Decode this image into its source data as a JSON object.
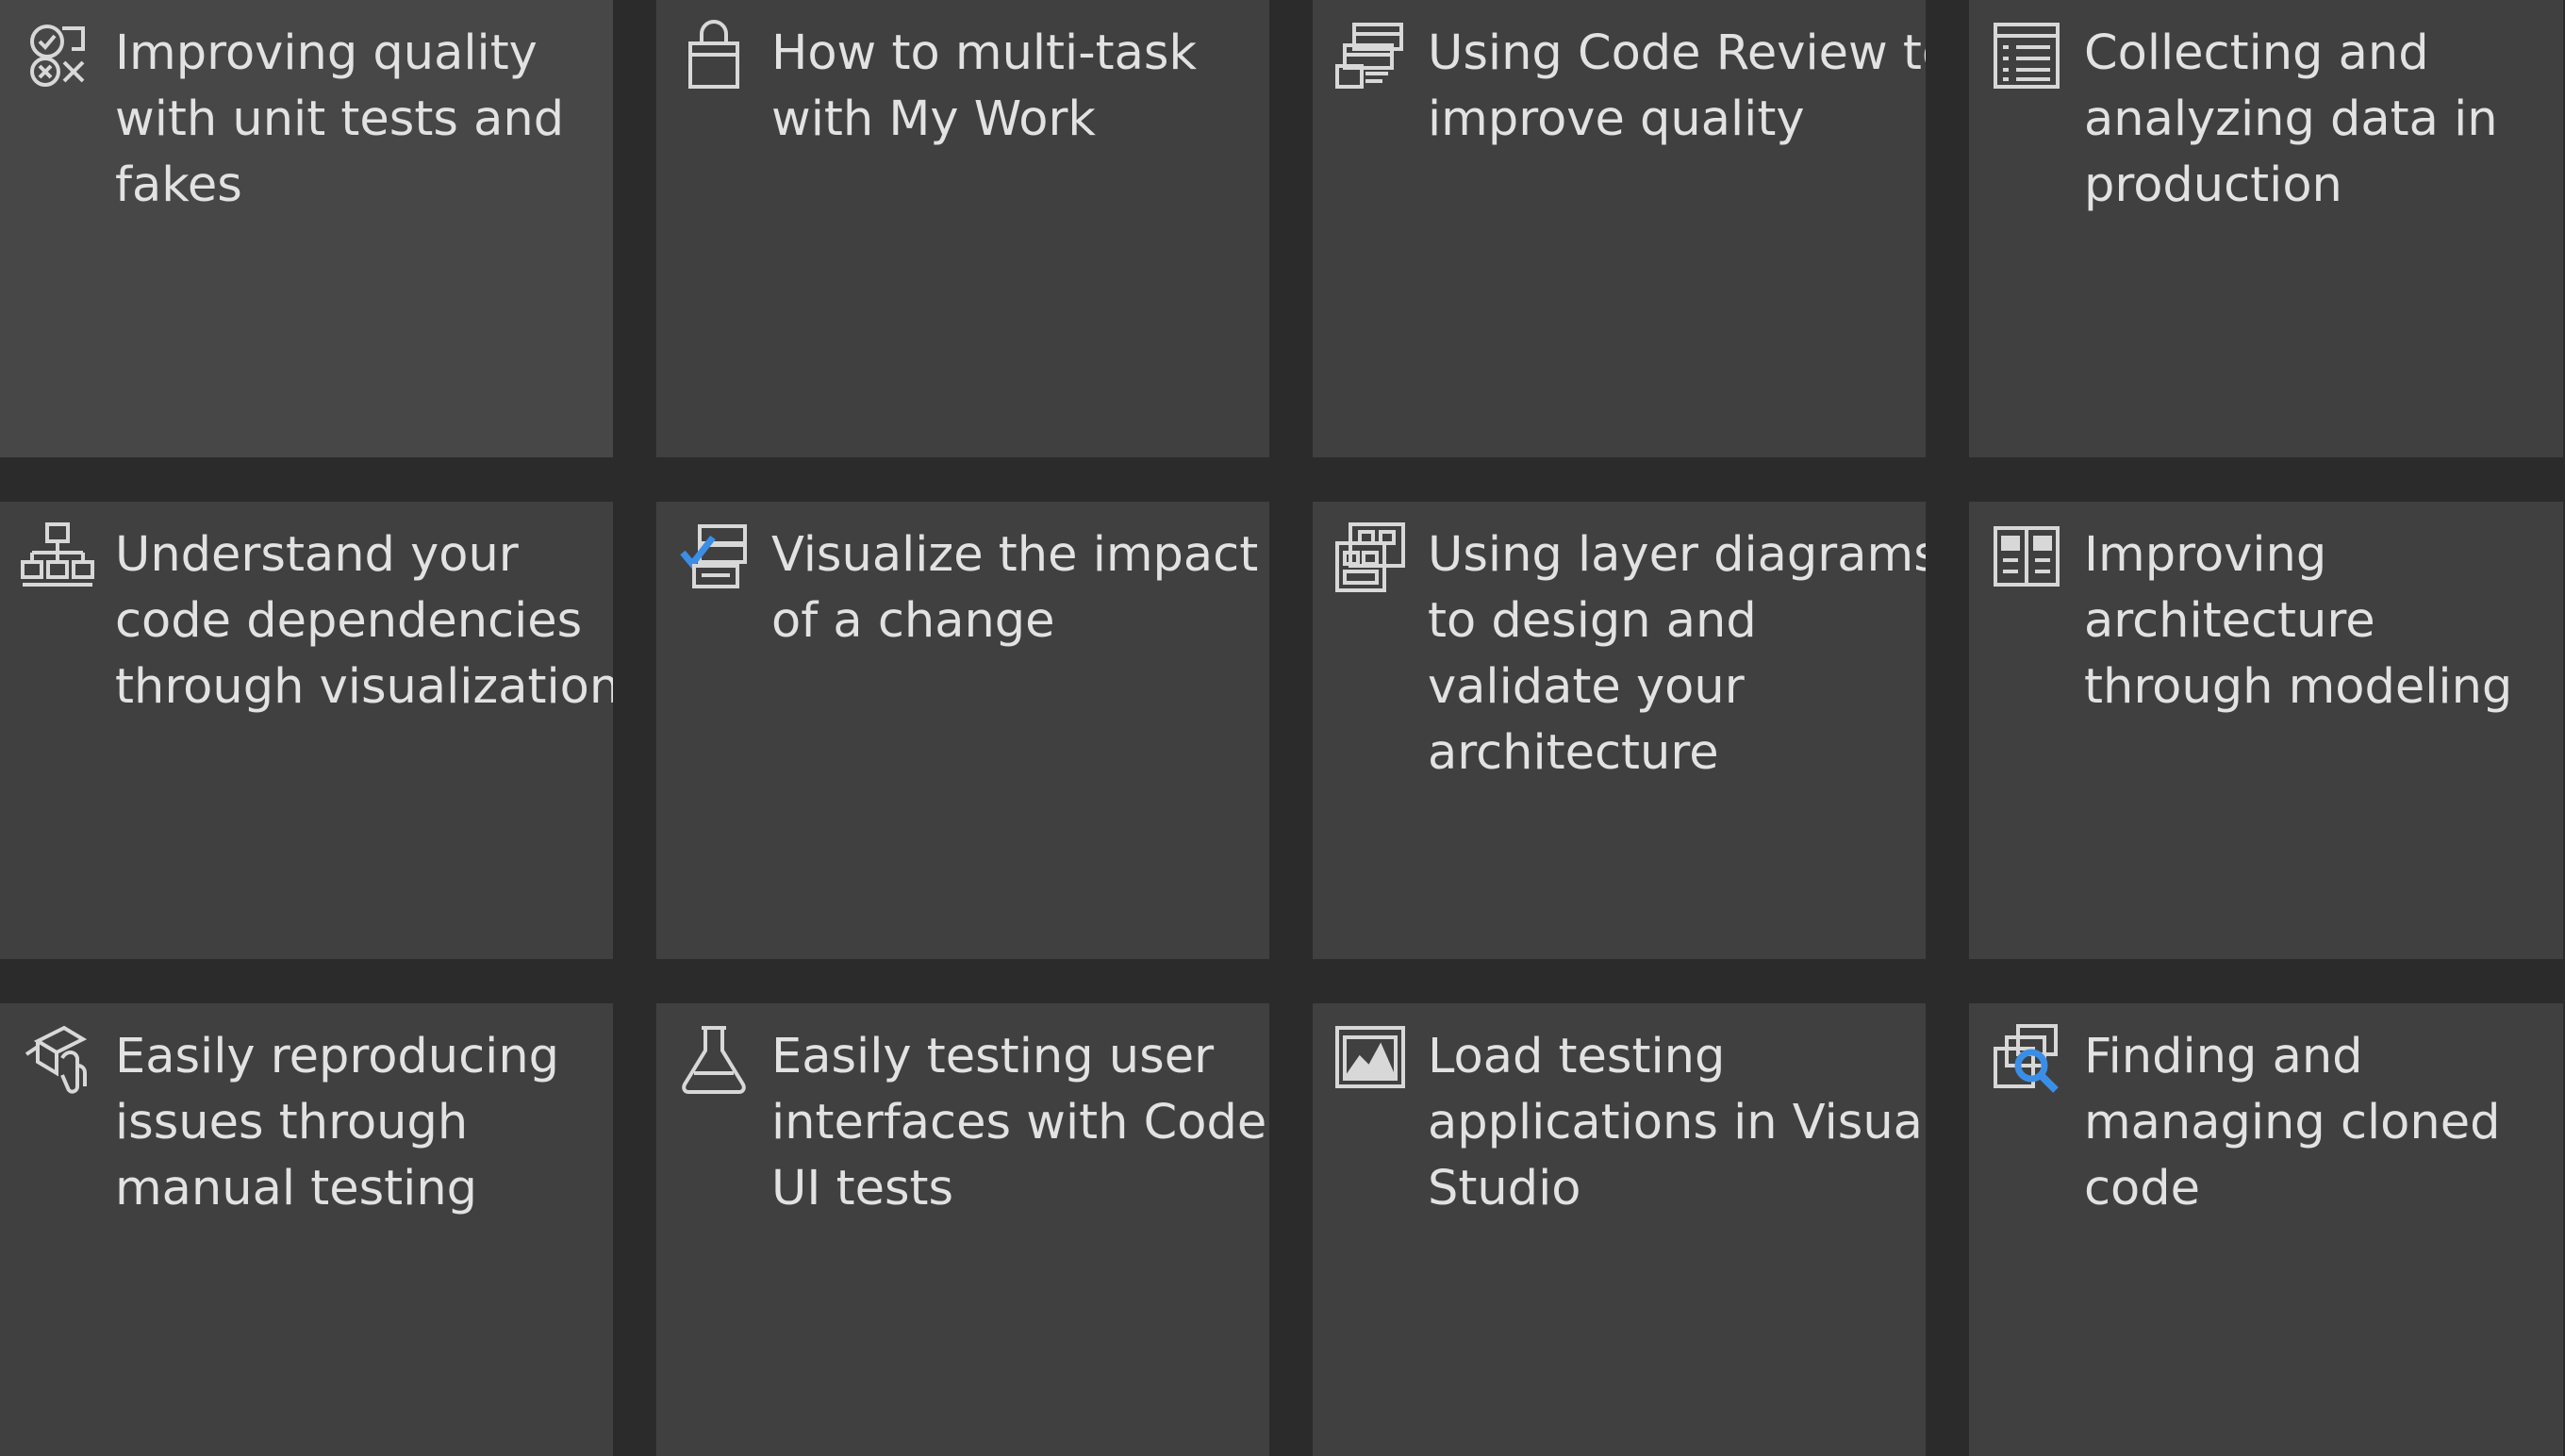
{
  "accent_color": "#3b8ee6",
  "tiles": [
    {
      "label": "Improving quality with unit tests and fakes",
      "icon": "unit-test-icon"
    },
    {
      "label": "How to multi-task with My Work",
      "icon": "my-work-icon"
    },
    {
      "label": "Using Code Review to improve quality",
      "icon": "code-review-icon"
    },
    {
      "label": "Collecting and analyzing data in production",
      "icon": "data-list-icon"
    },
    {
      "label": "Understand your code dependencies through visualization",
      "icon": "dependency-graph-icon"
    },
    {
      "label": "Visualize the impact of a change",
      "icon": "impact-checklist-icon"
    },
    {
      "label": "Using layer diagrams to design and validate your architecture",
      "icon": "layer-diagram-icon"
    },
    {
      "label": "Improving architecture through modeling",
      "icon": "model-diagram-icon"
    },
    {
      "label": "Easily reproducing issues through manual testing",
      "icon": "manual-test-icon"
    },
    {
      "label": "Easily testing user interfaces with Coded UI tests",
      "icon": "flask-icon"
    },
    {
      "label": "Load testing applications in Visual Studio",
      "icon": "load-test-icon"
    },
    {
      "label": "Finding and managing cloned code",
      "icon": "clone-search-icon"
    }
  ]
}
